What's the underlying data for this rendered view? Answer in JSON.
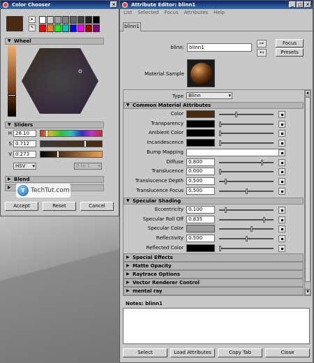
{
  "color_chooser": {
    "title": "Color Chooser",
    "palette": [
      "#ffffff",
      "#d0d0d0",
      "#a0a0a0",
      "#808080",
      "#606060",
      "#404040",
      "#202020",
      "#000000",
      "#ff0000",
      "#ff8000",
      "#00ff00",
      "#00c0c0",
      "#0000ff",
      "#ff00ff",
      "#a00000",
      "#800080"
    ],
    "current_color": "#4a2a12",
    "wheel_label": "Wheel",
    "sliders_label": "Sliders",
    "h_label": "H",
    "h_value": "28.10",
    "s_label": "S",
    "s_value": "0.712",
    "v_label": "V",
    "v_value": "0.273",
    "mode_value": "HSV",
    "range_value": "0 to 1",
    "blend_label": "Blend",
    "accept": "Accept",
    "reset": "Reset",
    "cancel": "Cancel",
    "watermark": "TechTut.com"
  },
  "attr_editor": {
    "title": "Attribute Editor: blinn1",
    "menu": [
      "List",
      "Selected",
      "Focus",
      "Attributes",
      "Help"
    ],
    "tab": "blinn1",
    "blinn_label": "blinn:",
    "blinn_value": "blinn1",
    "focus": "Focus",
    "presets": "Presets",
    "material_sample": "Material Sample",
    "type_label": "Type",
    "type_value": "Blinn",
    "common_header": "Common Material Attributes",
    "common": [
      {
        "label": "Color",
        "kind": "swatch",
        "swatch": "#4a2a12",
        "pos": 0.3
      },
      {
        "label": "Transparency",
        "kind": "swatch",
        "swatch": "#000000",
        "pos": 0.0
      },
      {
        "label": "Ambient Color",
        "kind": "swatch",
        "swatch": "#000000",
        "pos": 0.0
      },
      {
        "label": "Incandescence",
        "kind": "swatch",
        "swatch": "#000000",
        "pos": 0.0
      },
      {
        "label": "Bump Mapping",
        "kind": "text",
        "value": "",
        "pos": null
      },
      {
        "label": "Diffuse",
        "kind": "text",
        "value": "0.800",
        "pos": 0.8
      },
      {
        "label": "Translucence",
        "kind": "text",
        "value": "0.000",
        "pos": 0.0
      },
      {
        "label": "Translucence Depth",
        "kind": "text",
        "value": "0.500",
        "pos": 0.1
      },
      {
        "label": "Translucence Focus",
        "kind": "text",
        "value": "0.500",
        "pos": 0.5
      }
    ],
    "specular_header": "Specular Shading",
    "specular": [
      {
        "label": "Eccentricity",
        "kind": "text",
        "value": "0.100",
        "pos": 0.1
      },
      {
        "label": "Specular Roll Off",
        "kind": "text",
        "value": "0.835",
        "pos": 0.835
      },
      {
        "label": "Specular Color",
        "kind": "swatch",
        "swatch": "#9a9a9a",
        "pos": 0.6
      },
      {
        "label": "Reflectivity",
        "kind": "text",
        "value": "0.500",
        "pos": 0.5
      },
      {
        "label": "Reflected Color",
        "kind": "swatch",
        "swatch": "#000000",
        "pos": 0.0
      }
    ],
    "closed_sections": [
      "Special Effects",
      "Matte Opacity",
      "Raytrace Options",
      "Vector Renderer Control",
      "mental ray"
    ],
    "notes_label": "Notes:",
    "notes_value": "blinn1",
    "buttons": [
      "Select",
      "Load Attributes",
      "Copy Tab",
      "Close"
    ]
  }
}
